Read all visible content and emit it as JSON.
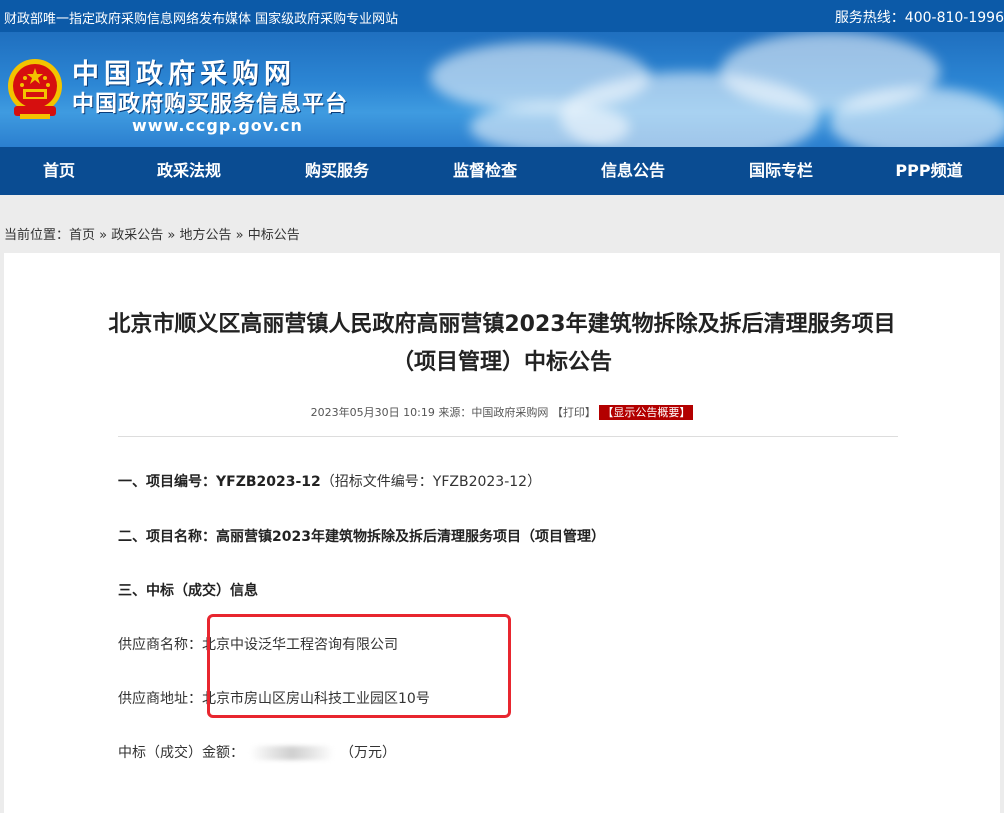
{
  "topbar": {
    "left_text": "财政部唯一指定政府采购信息网络发布媒体 国家级政府采购专业网站",
    "hotline": "服务热线：400-810-1996"
  },
  "brand": {
    "name_line1": "中国政府采购网",
    "name_line2": "中国政府购买服务信息平台",
    "url": "www.ccgp.gov.cn"
  },
  "nav": [
    {
      "label": "首页"
    },
    {
      "label": "政采法规"
    },
    {
      "label": "购买服务"
    },
    {
      "label": "监督检查"
    },
    {
      "label": "信息公告"
    },
    {
      "label": "国际专栏"
    },
    {
      "label": "PPP频道"
    }
  ],
  "breadcrumb": {
    "prefix": "当前位置：",
    "items": [
      "首页",
      "政采公告",
      "地方公告",
      "中标公告"
    ],
    "sep": " » "
  },
  "article": {
    "title_line1": "北京市顺义区高丽营镇人民政府高丽营镇2023年建筑物拆除及拆后清理服务项目",
    "title_line2": "（项目管理）中标公告",
    "meta_prefix": "2023年05月30日 10:19 来源：中国政府采购网 ",
    "print_label": "【打印】",
    "summary_label": "【显示公告概要】",
    "s1_label": "一、项目编号：",
    "s1_value": "YFZB2023-12",
    "s1_note": "（招标文件编号：YFZB2023-12）",
    "s2": "二、项目名称：高丽营镇2023年建筑物拆除及拆后清理服务项目（项目管理）",
    "s3": "三、中标（成交）信息",
    "supplier_name_label": "供应商名称：",
    "supplier_name": "北京中设泛华工程咨询有限公司",
    "supplier_addr_label": "供应商地址：",
    "supplier_addr": "北京市房山区房山科技工业园区10号",
    "amount_label": "中标（成交）金额：",
    "amount_unit": "（万元）"
  },
  "colors": {
    "topbar": "#0c5aa8",
    "nav": "#0a4c92",
    "highlight": "#e8262f",
    "badge": "#b30000"
  }
}
